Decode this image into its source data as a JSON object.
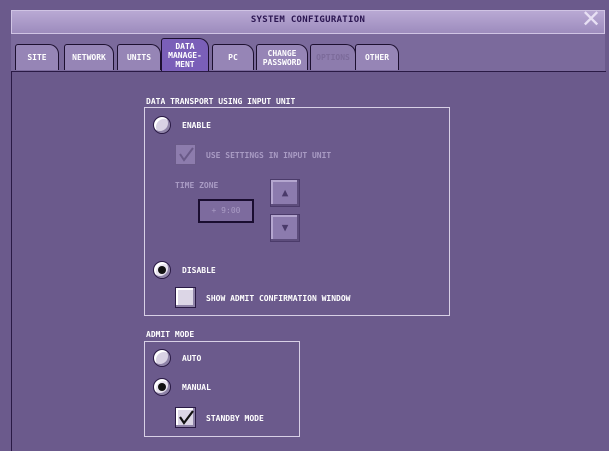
{
  "window": {
    "title": "SYSTEM CONFIGURATION",
    "close_icon": "close-icon"
  },
  "tabs": [
    {
      "label": "SITE",
      "state": "normal"
    },
    {
      "label": "NETWORK",
      "state": "normal"
    },
    {
      "label": "UNITS",
      "state": "normal"
    },
    {
      "label": "DATA MANAGE- MENT",
      "line1": "DATA",
      "line2": "MANAGE-",
      "line3": "MENT",
      "state": "active"
    },
    {
      "label": "PC",
      "state": "normal"
    },
    {
      "label": "CHANGE PASSWORD",
      "line1": "CHANGE",
      "line2": "PASSWORD",
      "state": "normal"
    },
    {
      "label": "OPTIONS",
      "state": "disabled"
    },
    {
      "label": "OTHER",
      "state": "normal"
    }
  ],
  "data_transport": {
    "heading": "DATA TRANSPORT USING INPUT UNIT",
    "enable_label": "ENABLE",
    "enable_selected": false,
    "use_settings_label": "USE SETTINGS IN INPUT UNIT",
    "use_settings_checked": true,
    "use_settings_disabled": true,
    "time_zone_label": "TIME ZONE",
    "time_zone_value": "+  9:00",
    "up_icon": "triangle-up-icon",
    "down_icon": "triangle-down-icon",
    "disable_label": "DISABLE",
    "disable_selected": true,
    "show_admit_label": "SHOW ADMIT CONFIRMATION WINDOW",
    "show_admit_checked": false
  },
  "admit_mode": {
    "heading": "ADMIT MODE",
    "auto_label": "AUTO",
    "auto_selected": false,
    "manual_label": "MANUAL",
    "manual_selected": true,
    "standby_label": "STANDBY MODE",
    "standby_checked": true
  },
  "colors": {
    "background": "#6b5a8c",
    "active_tab": "#7a5fb8",
    "titlebar": "#b9a9d4"
  }
}
